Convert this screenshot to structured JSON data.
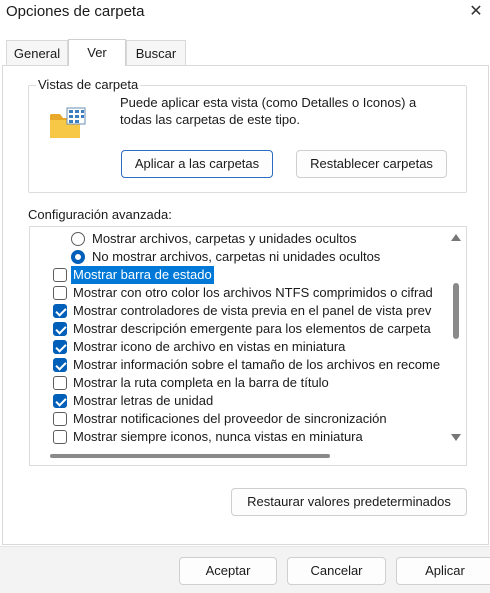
{
  "window": {
    "title": "Opciones de carpeta",
    "close_glyph": "✕"
  },
  "tabs": [
    {
      "label": "General"
    },
    {
      "label": "Ver"
    },
    {
      "label": "Buscar"
    }
  ],
  "folder_views": {
    "legend": "Vistas de carpeta",
    "icon": "folder-icon",
    "description": "Puede aplicar esta vista (como Detalles o Iconos) a todas las carpetas de este tipo.",
    "apply_label": "Aplicar a las carpetas",
    "reset_label": "Restablecer carpetas"
  },
  "advanced": {
    "label": "Configuración avanzada:",
    "items": [
      {
        "text": "Mostrar archivos, carpetas y unidades ocultos",
        "kind": "radio",
        "checked": false
      },
      {
        "text": "No mostrar archivos, carpetas ni unidades ocultos",
        "kind": "radio",
        "checked": true
      },
      {
        "text": "Mostrar barra de estado",
        "kind": "checkbox",
        "checked": false,
        "selected": true
      },
      {
        "text": "Mostrar con otro color los archivos NTFS comprimidos o cifrad",
        "kind": "checkbox",
        "checked": false
      },
      {
        "text": "Mostrar controladores de vista previa en el panel de vista prev",
        "kind": "checkbox",
        "checked": true
      },
      {
        "text": "Mostrar descripción emergente para los elementos de carpeta",
        "kind": "checkbox",
        "checked": true
      },
      {
        "text": "Mostrar icono de archivo en vistas en miniatura",
        "kind": "checkbox",
        "checked": true
      },
      {
        "text": "Mostrar información sobre el tamaño de los archivos en recome",
        "kind": "checkbox",
        "checked": true
      },
      {
        "text": "Mostrar la ruta completa en la barra de título",
        "kind": "checkbox",
        "checked": false
      },
      {
        "text": "Mostrar letras de unidad",
        "kind": "checkbox",
        "checked": true
      },
      {
        "text": "Mostrar notificaciones del proveedor de sincronización",
        "kind": "checkbox",
        "checked": false
      },
      {
        "text": "Mostrar siempre iconos, nunca vistas en miniatura",
        "kind": "checkbox",
        "checked": false
      }
    ]
  },
  "restore_label": "Restaurar valores predeterminados",
  "footer": {
    "ok_label": "Aceptar",
    "cancel_label": "Cancelar",
    "apply_label": "Aplicar"
  },
  "colors": {
    "accent": "#005fb8",
    "selection": "#0078d7"
  }
}
